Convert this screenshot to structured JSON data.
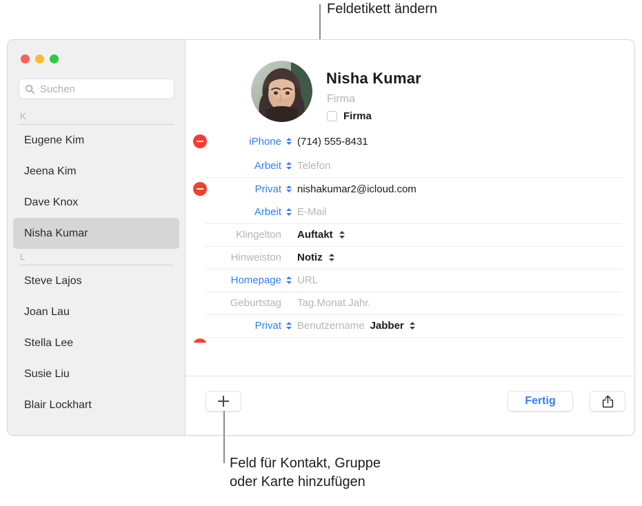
{
  "callouts": {
    "top": "Feldetikett ändern",
    "bottom": "Feld für Kontakt, Gruppe\noder Karte hinzufügen"
  },
  "window": {
    "traffic_lights": [
      {
        "name": "close",
        "color": "#fc5f57"
      },
      {
        "name": "minimize",
        "color": "#fdbc2e"
      },
      {
        "name": "zoom",
        "color": "#2dc93f"
      }
    ]
  },
  "sidebar": {
    "search": {
      "icon": "search-icon",
      "placeholder": "Suchen",
      "value": ""
    },
    "groups": [
      {
        "letter": "K",
        "contacts": [
          {
            "name": "Eugene Kim",
            "selected": false
          },
          {
            "name": "Jeena Kim",
            "selected": false
          },
          {
            "name": "Dave Knox",
            "selected": false
          },
          {
            "name": "Nisha Kumar",
            "selected": true
          }
        ]
      },
      {
        "letter": "L",
        "contacts": [
          {
            "name": "Steve Lajos",
            "selected": false
          },
          {
            "name": "Joan Lau",
            "selected": false
          },
          {
            "name": "Stella Lee",
            "selected": false
          },
          {
            "name": "Susie Liu",
            "selected": false
          },
          {
            "name": "Blair Lockhart",
            "selected": false
          }
        ]
      }
    ]
  },
  "detail": {
    "avatar": "contact-photo",
    "name": "Nisha  Kumar",
    "company_placeholder": "Firma",
    "company_checkbox_label": "Firma",
    "fields": [
      {
        "id": "phone-iphone",
        "has_delete": true,
        "label": "iPhone",
        "label_style": "link",
        "has_label_stepper": true,
        "value": "(714) 555-8431",
        "value_style": "filled",
        "separator": false
      },
      {
        "id": "phone-work",
        "has_delete": false,
        "label": "Arbeit",
        "label_style": "link",
        "has_label_stepper": true,
        "value": "Telefon",
        "value_style": "placeholder",
        "separator": false
      },
      {
        "id": "email-home",
        "has_delete": true,
        "label": "Privat",
        "label_style": "link",
        "has_label_stepper": true,
        "value": "nishakumar2@icloud.com",
        "value_style": "filled",
        "separator": true
      },
      {
        "id": "email-work",
        "has_delete": false,
        "label": "Arbeit",
        "label_style": "link",
        "has_label_stepper": true,
        "value": "E-Mail",
        "value_style": "placeholder",
        "separator": false
      },
      {
        "id": "ringtone",
        "has_delete": false,
        "label": "Klingelton",
        "label_style": "muted",
        "has_label_stepper": false,
        "value": "Auftakt",
        "value_style": "bold",
        "value_stepper": true,
        "separator": true
      },
      {
        "id": "texttone",
        "has_delete": false,
        "label": "Hinweiston",
        "label_style": "muted",
        "has_label_stepper": false,
        "value": "Notiz",
        "value_style": "bold",
        "value_stepper": true,
        "separator": true
      },
      {
        "id": "homepage",
        "has_delete": false,
        "label": "Homepage",
        "label_style": "link",
        "has_label_stepper": true,
        "value": "URL",
        "value_style": "placeholder",
        "separator": true
      },
      {
        "id": "birthday",
        "has_delete": false,
        "label": "Geburtstag",
        "label_style": "muted",
        "has_label_stepper": false,
        "value": "Tag.Monat.Jahr.",
        "value_style": "placeholder",
        "separator": true
      },
      {
        "id": "im-home",
        "has_delete": false,
        "label": "Privat",
        "label_style": "link",
        "has_label_stepper": true,
        "value": "Benutzername",
        "value_style": "placeholder",
        "service": "Jabber",
        "service_stepper": true,
        "separator": true
      }
    ]
  },
  "bottom_bar": {
    "add_field": {
      "icon": "plus-icon",
      "label": ""
    },
    "done_label": "Fertig",
    "share": {
      "icon": "share-icon"
    }
  },
  "colors": {
    "accent_blue": "#2f80f7",
    "delete_red": "#fa3c2d",
    "placeholder_gray": "#b6b6b6",
    "selection_gray": "#d6d6d6"
  }
}
